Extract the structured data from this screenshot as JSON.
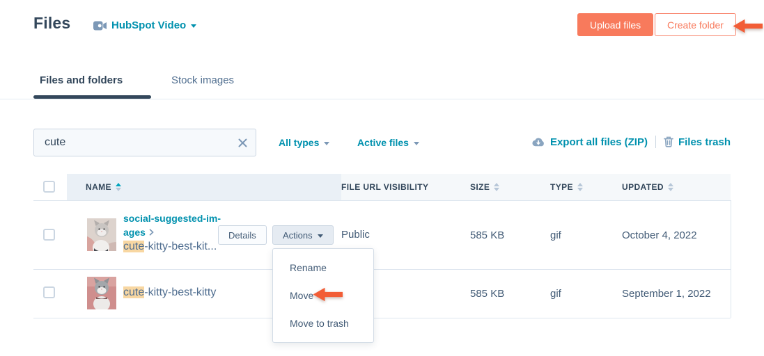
{
  "header": {
    "title": "Files",
    "video_selector": {
      "label": "HubSpot Video"
    },
    "upload_button": "Upload files",
    "create_folder_button": "Create folder"
  },
  "tabs": [
    {
      "label": "Files and folders",
      "active": true
    },
    {
      "label": "Stock images",
      "active": false
    }
  ],
  "toolbar": {
    "search": {
      "value": "cute"
    },
    "filters": [
      {
        "label": "All types"
      },
      {
        "label": "Active files"
      }
    ],
    "export_link": "Export all files (ZIP)",
    "trash_link": "Files trash"
  },
  "table": {
    "columns": [
      {
        "label": "NAME",
        "sort": "asc"
      },
      {
        "label": "FILE URL VISIBILITY",
        "sort": "none"
      },
      {
        "label": "SIZE",
        "sort": "unsorted"
      },
      {
        "label": "TYPE",
        "sort": "unsorted"
      },
      {
        "label": "UPDATED",
        "sort": "unsorted"
      }
    ],
    "rows": [
      {
        "folder_line1": "social-suggested-im-",
        "folder_line2": "ages",
        "name_highlight": "cute",
        "name_rest": "-kitty-best-kit...",
        "details_button": "Details",
        "actions_button": "Actions",
        "visibility": "Public",
        "size": "585 KB",
        "type": "gif",
        "updated": "October 4, 2022"
      },
      {
        "name_highlight": "cute",
        "name_rest": "-kitty-best-kitty",
        "size": "585 KB",
        "type": "gif",
        "updated": "September 1, 2022"
      }
    ]
  },
  "actions_menu": {
    "items": [
      "Rename",
      "Move",
      "Move to trash"
    ]
  },
  "icons": {
    "video_selector": "video-camera-icon",
    "search_clear": "close-icon",
    "export": "cloud-download-icon",
    "trash": "trash-icon",
    "sort": "sort-arrows-icon",
    "annotations": "arrow-left-icon"
  },
  "colors": {
    "accent_orange": "#f87a5c",
    "annotation_arrow": "#ff5c35",
    "link_teal": "#0091ae",
    "sort_active_teal": "#00a4bd",
    "navy": "#33475b",
    "search_highlight": "#f8d7a2",
    "header_row_bg": "#f5f8fa",
    "sorted_col_bg": "#eaf0f6"
  }
}
